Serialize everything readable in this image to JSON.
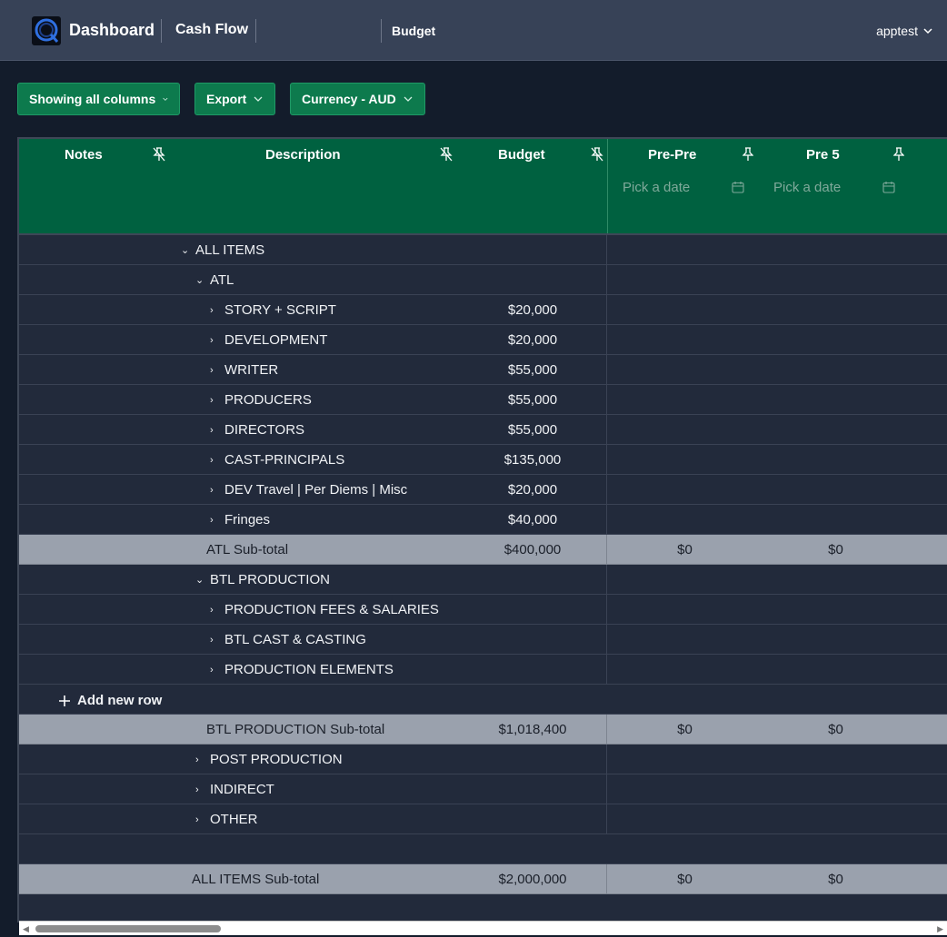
{
  "nav": {
    "dashboard": "Dashboard",
    "cash_flow": "Cash Flow",
    "budget": "Budget",
    "user": "apptest"
  },
  "toolbar": {
    "columns": "Showing all columns",
    "export": "Export",
    "currency": "Currency - AUD"
  },
  "columns": {
    "notes": "Notes",
    "description": "Description",
    "budget": "Budget",
    "pre_pre": "Pre-Pre",
    "pre5": "Pre 5",
    "date_placeholder": "Pick a date"
  },
  "rows": [
    {
      "label": "ALL ITEMS",
      "budget": "",
      "c1": "",
      "c2": ""
    },
    {
      "label": "ATL",
      "budget": "",
      "c1": "",
      "c2": ""
    },
    {
      "label": "STORY + SCRIPT",
      "budget": "$20,000",
      "c1": "",
      "c2": ""
    },
    {
      "label": "DEVELOPMENT",
      "budget": "$20,000",
      "c1": "",
      "c2": ""
    },
    {
      "label": "WRITER",
      "budget": "$55,000",
      "c1": "",
      "c2": ""
    },
    {
      "label": "PRODUCERS",
      "budget": "$55,000",
      "c1": "",
      "c2": ""
    },
    {
      "label": "DIRECTORS",
      "budget": "$55,000",
      "c1": "",
      "c2": ""
    },
    {
      "label": "CAST-PRINCIPALS",
      "budget": "$135,000",
      "c1": "",
      "c2": ""
    },
    {
      "label": "DEV Travel | Per Diems | Misc",
      "budget": "$20,000",
      "c1": "",
      "c2": ""
    },
    {
      "label": "Fringes",
      "budget": "$40,000",
      "c1": "",
      "c2": ""
    },
    {
      "label": "ATL Sub-total",
      "budget": "$400,000",
      "c1": "$0",
      "c2": "$0"
    },
    {
      "label": "BTL PRODUCTION",
      "budget": "",
      "c1": "",
      "c2": ""
    },
    {
      "label": "PRODUCTION FEES & SALARIES",
      "budget": "",
      "c1": "",
      "c2": ""
    },
    {
      "label": "BTL CAST & CASTING",
      "budget": "",
      "c1": "",
      "c2": ""
    },
    {
      "label": "PRODUCTION ELEMENTS",
      "budget": "",
      "c1": "",
      "c2": ""
    },
    {
      "label": "Add new row",
      "budget": "",
      "c1": "",
      "c2": ""
    },
    {
      "label": "BTL PRODUCTION Sub-total",
      "budget": "$1,018,400",
      "c1": "$0",
      "c2": "$0"
    },
    {
      "label": "POST PRODUCTION",
      "budget": "",
      "c1": "",
      "c2": ""
    },
    {
      "label": "INDIRECT",
      "budget": "",
      "c1": "",
      "c2": ""
    },
    {
      "label": "OTHER",
      "budget": "",
      "c1": "",
      "c2": ""
    },
    {
      "label": "",
      "budget": "",
      "c1": "",
      "c2": ""
    },
    {
      "label": "ALL ITEMS Sub-total",
      "budget": "$2,000,000",
      "c1": "$0",
      "c2": "$0"
    }
  ]
}
